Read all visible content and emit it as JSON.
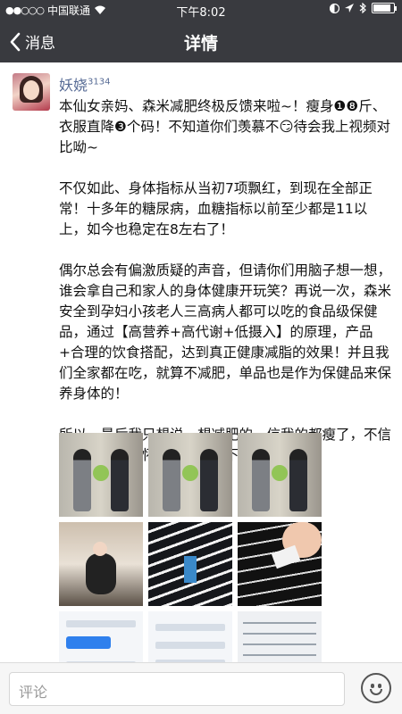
{
  "status_bar": {
    "signal_dots": "●●○○○",
    "carrier": "中国联通",
    "time": "下午8:02"
  },
  "nav": {
    "back_label": "消息",
    "title": "详情"
  },
  "post": {
    "username": "妖娆",
    "username_suffix": "3134",
    "paragraphs": [
      "本仙女亲妈、森米减肥终极反馈来啦~！瘦身❶❽斤、衣服直降❸个码！不知道你们羡慕不😏待会我上视频对比呦~",
      "不仅如此、身体指标从当初7项飘红，到现在全部正常！十多年的糖尿病，血糖指标以前至少都是11以上，如今也稳定在8左右了！",
      "偶尔总会有偏激质疑的声音，但请你们用脑子想一想，谁会拿自己和家人的身体健康开玩笑？再说一次，森米安全到孕妇小孩老人三高病人都可以吃的食品级保健品，通过【高营养+高代谢+低摄入】的原理，产品+合理的饮食搭配，达到真正健康减脂的效果！并且我们全家都在吃，就算不减肥，单品也是作为保健品来保养身体的！",
      "所以，最后我只想说，想减肥的，信我的都瘦了，不信的，你就继续怀疑，接着胖下去吧😏"
    ]
  },
  "comment_bar": {
    "placeholder": "评论"
  },
  "colors": {
    "nav_bg": "#393a3f",
    "username": "#576b95"
  }
}
